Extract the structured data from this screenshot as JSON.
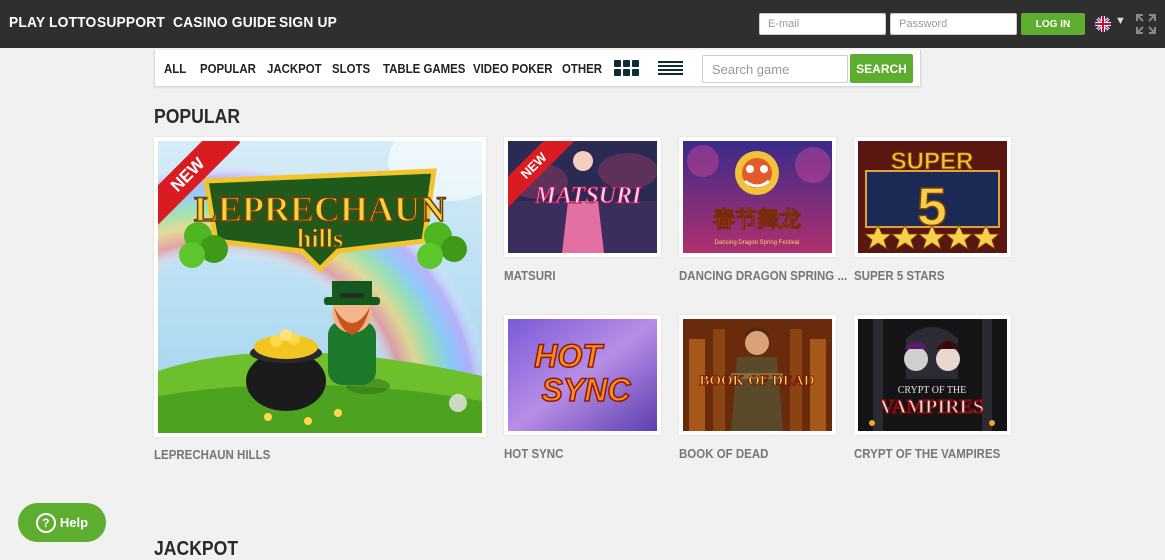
{
  "header": {
    "nav": [
      "PLAY LOTTO",
      "SUPPORT",
      "CASINO GUIDE",
      "SIGN UP"
    ],
    "email_placeholder": "E-mail",
    "password_placeholder": "Password",
    "login_label": "LOG IN",
    "language_icon": "uk-flag-icon",
    "fullscreen_icon": "expand-icon"
  },
  "filters": {
    "items": [
      "ALL",
      "POPULAR",
      "JACKPOT",
      "SLOTS",
      "TABLE GAMES",
      "VIDEO POKER",
      "OTHER"
    ],
    "grid_view_icon": "grid-view-icon",
    "list_view_icon": "list-view-icon",
    "search_placeholder": "Search game",
    "search_label": "SEARCH"
  },
  "sections": {
    "popular_title": "POPULAR",
    "jackpot_title": "JACKPOT"
  },
  "games": {
    "featured": {
      "name": "LEPRECHAUN HILLS",
      "badge": "NEW",
      "art_text_1": "LEPRECHAUN",
      "art_text_2": "hills"
    },
    "tiles": [
      {
        "name": "MATSURI",
        "badge": "NEW",
        "art_text": "MATSURI"
      },
      {
        "name": "DANCING DRAGON SPRING ...",
        "art_text": "春节舞龙",
        "art_sub": "Dancing   Dragon   Spring   Festival"
      },
      {
        "name": "SUPER 5 STARS",
        "art_text": "SUPER",
        "art_num": "5"
      },
      {
        "name": "HOT SYNC",
        "art_text": "HOT",
        "art_text_2": "SYNC"
      },
      {
        "name": "BOOK OF DEAD",
        "art_text": "BOOK OF DEAD"
      },
      {
        "name": "CRYPT OF THE VAMPIRES",
        "art_text": "CRYPT OF THE",
        "art_text_2": "VAMPIRES"
      }
    ]
  },
  "help": {
    "label": "Help",
    "icon": "question-icon"
  },
  "colors": {
    "accent": "#5dae2e",
    "topbar": "#2f2f2f",
    "badge": "#d81c22"
  }
}
